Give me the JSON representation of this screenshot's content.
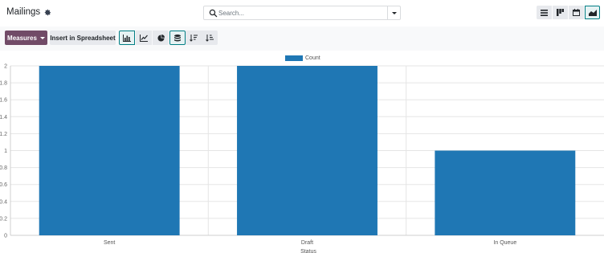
{
  "header": {
    "title": "Mailings",
    "settings_icon": "gear-icon"
  },
  "search": {
    "placeholder": "Search...",
    "icon": "search-icon",
    "toggle_icon": "caret-down-icon"
  },
  "view_switcher": [
    {
      "icon": "list-view-icon",
      "active": false
    },
    {
      "icon": "kanban-view-icon",
      "active": false
    },
    {
      "icon": "calendar-view-icon",
      "active": false
    },
    {
      "icon": "graph-view-icon",
      "active": true
    }
  ],
  "toolbar": {
    "measures_label": "Measures",
    "spreadsheet_label": "Insert in Spreadsheet",
    "chart_type_buttons": [
      {
        "icon": "bar-chart-icon",
        "active": true
      },
      {
        "icon": "line-chart-icon",
        "active": false
      },
      {
        "icon": "pie-chart-icon",
        "active": false
      }
    ],
    "option_buttons": [
      {
        "icon": "stacked-icon",
        "active": true
      },
      {
        "icon": "sort-descending-icon",
        "active": false
      },
      {
        "icon": "sort-ascending-icon",
        "active": false
      }
    ]
  },
  "colors": {
    "brand": "#714b67",
    "accent": "#017e84",
    "bar": "#1f77b4"
  },
  "chart_data": {
    "type": "bar",
    "categories": [
      "Sent",
      "Draft",
      "In Queue"
    ],
    "series": [
      {
        "name": "Count",
        "values": [
          2,
          2,
          1
        ]
      }
    ],
    "xlabel": "Status",
    "ylabel": "",
    "ylim": [
      0,
      2
    ],
    "yticks": [
      "0",
      "0.2",
      "0.4",
      "0.6",
      "0.8",
      "1",
      "1.2",
      "1.4",
      "1.6",
      "1.8",
      "2"
    ],
    "grid": true,
    "legend": "top-center"
  }
}
